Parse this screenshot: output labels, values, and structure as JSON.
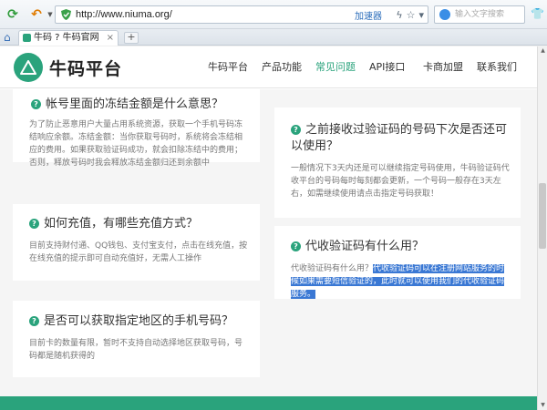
{
  "browser": {
    "url": "http://www.niuma.org/",
    "accelerator_label": "加速器",
    "search_placeholder": "输入文字搜索",
    "tab_title": "牛码 ? 牛码官网",
    "new_tab_label": "+"
  },
  "site": {
    "logo_text": "牛码平台",
    "nav": [
      {
        "label": "牛码平台"
      },
      {
        "label": "产品功能"
      },
      {
        "label": "常见问题"
      },
      {
        "label": "API接口"
      },
      {
        "label": "卡商加盟"
      },
      {
        "label": "联系我们"
      }
    ],
    "active_nav": "常见问题",
    "accent_color": "#2aa37c"
  },
  "faq": [
    {
      "title": "帐号里面的冻结金额是什么意思？",
      "body": "为了防止恶意用户大量占用系统资源，获取一个手机号码冻结响应余额。冻结金额：当你获取号码时，系统将会冻结相应的费用。如果获取验证码成功，就会扣除冻结中的费用；否则，释放号码时我会释放冻结金额归还到余额中"
    },
    {
      "title": "之前接收过验证码的号码下次是否还可以使用？",
      "body": "一般情况下3天内还是可以继续指定号码使用，牛码验证码代收平台的号码每时每刻都会更新，一个号码一般存在3天左右，如需继续使用请点击指定号码获取！"
    },
    {
      "title": "如何充值，有哪些充值方式？",
      "body": "目前支持财付通、QQ钱包、支付宝支付，点击在线充值，按在线充值的提示即可自动充值好，无需人工操作"
    },
    {
      "title": "代收验证码有什么用？",
      "body_prefix": "代收验证码有什么用？",
      "body_highlight": "代收验证码可以在注册网站服务的时候如果需要短信验证的，此时就可以使用我们的代收验证码服务。"
    },
    {
      "title": "是否可以获取指定地区的手机号码？",
      "body": "目前卡的数量有限，暂时不支持自动选择地区获取号码，号码都是随机获得的"
    }
  ],
  "q_icon_glyph": "?"
}
